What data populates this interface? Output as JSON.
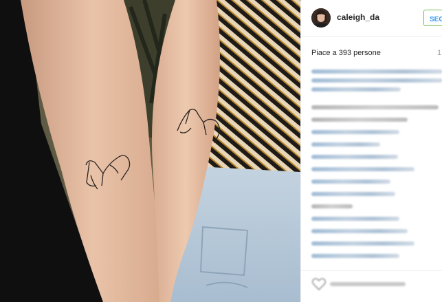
{
  "post": {
    "username": "caleigh_da",
    "follow_label": "SEGUI",
    "likes_text": "Piace a 393 persone",
    "likes_side_digit": "1"
  },
  "photo": {
    "description_icon": "photo-image"
  },
  "comments": {
    "count": 18
  },
  "footer": {
    "like_icon": "heart-icon"
  }
}
